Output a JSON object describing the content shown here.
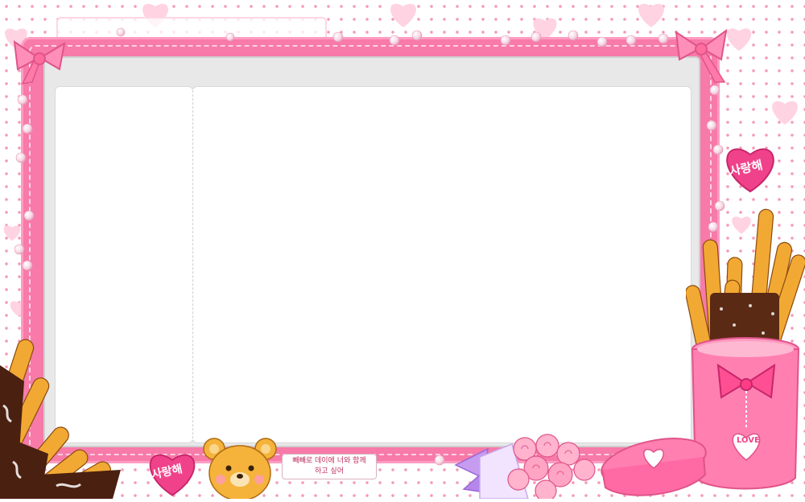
{
  "decor": {
    "love_badge_top": "사랑해",
    "love_badge_bottom": "사랑해",
    "speech_line1": "빼빼로 데이에 너와 함께",
    "speech_line2": "하고 싶어",
    "cup_label": "LOVE"
  },
  "colors": {
    "frame_pink": "#f77aa8",
    "hot_pink": "#f0428a",
    "dot_pink": "#f59ab8",
    "screen_gray": "#e8e8e8",
    "page_white": "#ffffff"
  },
  "icons": [
    "heart-icon",
    "bow-icon",
    "pocky-stick-icon",
    "teddy-bear-icon",
    "rose-bouquet-icon",
    "gift-box-icon",
    "pearl-icon"
  ]
}
